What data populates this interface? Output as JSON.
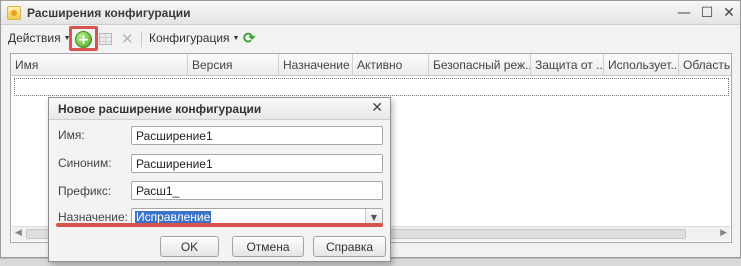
{
  "window": {
    "title": "Расширения конфигурации",
    "minimize_glyph": "—",
    "maximize_glyph": "☐",
    "close_glyph": "✕"
  },
  "toolbar": {
    "actions_label": "Действия",
    "configuration_label": "Конфигурация",
    "add_icon": "+",
    "delete_icon": "✕",
    "refresh_icon": "⟳"
  },
  "table": {
    "columns": [
      "Имя",
      "Версия",
      "Назначение",
      "Активно",
      "Безопасный реж...",
      "Защита от ...",
      "Использует...",
      "Область ..."
    ]
  },
  "dialog": {
    "title": "Новое расширение конфигурации",
    "close_glyph": "✕",
    "fields": {
      "name": {
        "label": "Имя:",
        "value": "Расширение1"
      },
      "synonym": {
        "label": "Синоним:",
        "value": "Расширение1"
      },
      "prefix": {
        "label": "Префикс:",
        "value": "Расш1_"
      },
      "purpose": {
        "label": "Назначение:",
        "value": "Исправление"
      }
    },
    "buttons": {
      "ok": "OK",
      "cancel": "Отмена",
      "help": "Справка"
    }
  },
  "colors": {
    "highlight_red": "#d9534f",
    "selection_blue": "#3b73c9",
    "add_green": "#45a81e"
  }
}
